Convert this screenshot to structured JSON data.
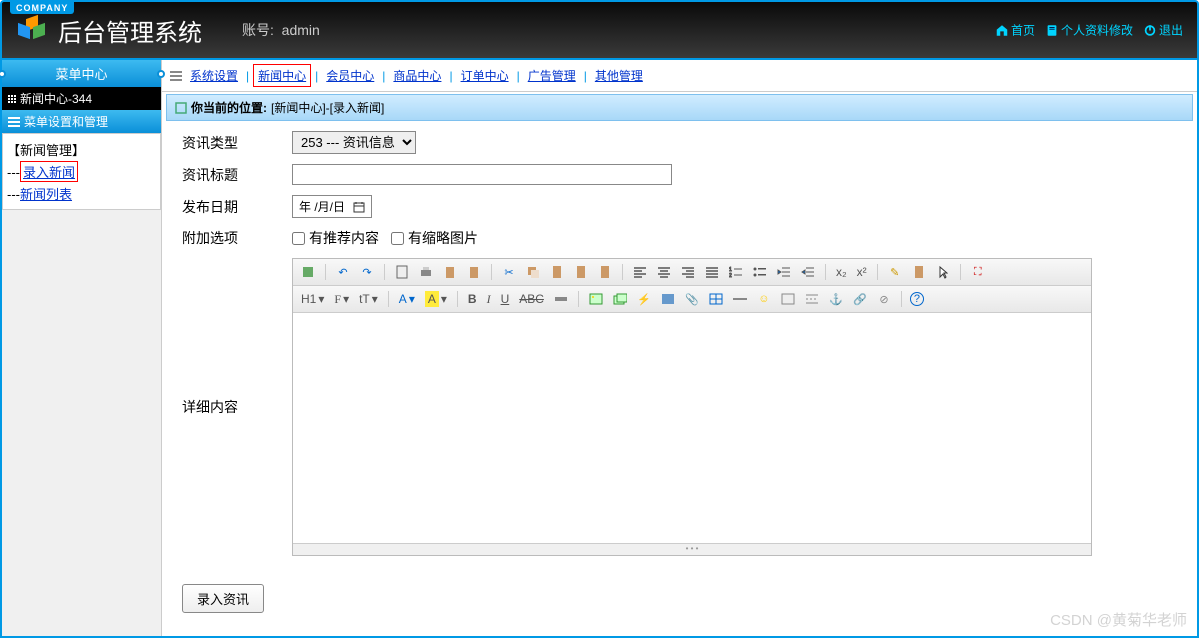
{
  "company_tag": "COMPANY",
  "system_title": "后台管理系统",
  "account_label": "账号:",
  "account_value": "admin",
  "top_buttons": {
    "home": "首页",
    "profile": "个人资料修改",
    "logout": "退出"
  },
  "sidebar": {
    "header": "菜单中心",
    "sub_header": "新闻中心-344",
    "section_title": "菜单设置和管理",
    "group_title": "【新闻管理】",
    "items": [
      {
        "prefix": "---",
        "label": "录入新闻",
        "highlighted": true
      },
      {
        "prefix": "---",
        "label": "新闻列表",
        "highlighted": false
      }
    ]
  },
  "tabs": [
    {
      "label": "系统设置",
      "active": false
    },
    {
      "label": "新闻中心",
      "active": true
    },
    {
      "label": "会员中心",
      "active": false
    },
    {
      "label": "商品中心",
      "active": false
    },
    {
      "label": "订单中心",
      "active": false
    },
    {
      "label": "广告管理",
      "active": false
    },
    {
      "label": "其他管理",
      "active": false
    }
  ],
  "breadcrumb": {
    "prefix": "你当前的位置:",
    "path": "[新闻中心]-[录入新闻]"
  },
  "form": {
    "type_label": "资讯类型",
    "type_options": [
      "253 --- 资讯信息"
    ],
    "type_selected": "253 --- 资讯信息",
    "title_label": "资讯标题",
    "title_value": "",
    "date_label": "发布日期",
    "date_placeholder": "年 /月/日",
    "extra_label": "附加选项",
    "chk_recommend": "有推荐内容",
    "chk_thumb": "有缩略图片",
    "detail_label": "详细内容",
    "submit_label": "录入资讯"
  },
  "editor_toolbar": {
    "h1": "H1",
    "font": "F",
    "size": "tT",
    "color": "A",
    "bg": "A",
    "bold": "B",
    "italic": "I",
    "underline": "U",
    "strike": "ABC",
    "sub": "x₂",
    "sup": "x²"
  },
  "watermark": "CSDN @黄菊华老师"
}
